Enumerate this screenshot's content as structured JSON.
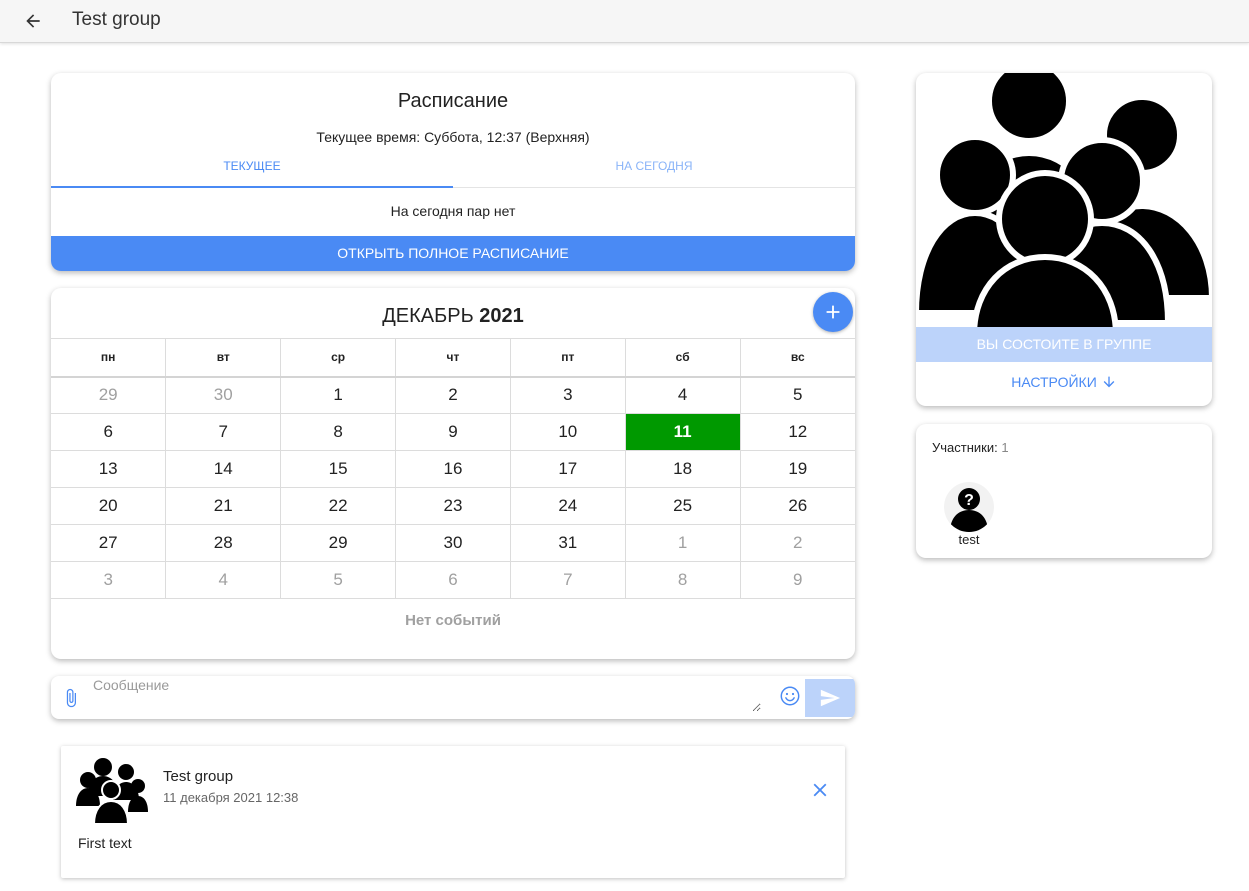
{
  "header": {
    "title": "Test group",
    "back_icon": "arrow-left-icon"
  },
  "schedule": {
    "title": "Расписание",
    "current_time": "Текущее время: Суббота, 12:37 (Верхняя)",
    "tabs": [
      {
        "label": "ТЕКУЩЕЕ",
        "active": true
      },
      {
        "label": "НА СЕГОДНЯ",
        "active": false
      }
    ],
    "no_classes_text": "На сегодня пар нет",
    "open_full_label": "ОТКРЫТЬ ПОЛНОЕ РАСПИСАНИЕ",
    "accent_color": "#4a8af4"
  },
  "calendar": {
    "month": "ДЕКАБРЬ",
    "year": "2021",
    "add_icon": "plus-icon",
    "weekdays": [
      "пн",
      "вт",
      "ср",
      "чт",
      "пт",
      "сб",
      "вс"
    ],
    "weeks": [
      [
        {
          "d": "29",
          "m": true
        },
        {
          "d": "30",
          "m": true
        },
        {
          "d": "1"
        },
        {
          "d": "2"
        },
        {
          "d": "3"
        },
        {
          "d": "4"
        },
        {
          "d": "5"
        }
      ],
      [
        {
          "d": "6"
        },
        {
          "d": "7"
        },
        {
          "d": "8"
        },
        {
          "d": "9"
        },
        {
          "d": "10"
        },
        {
          "d": "11",
          "today": true
        },
        {
          "d": "12"
        }
      ],
      [
        {
          "d": "13"
        },
        {
          "d": "14"
        },
        {
          "d": "15"
        },
        {
          "d": "16"
        },
        {
          "d": "17"
        },
        {
          "d": "18"
        },
        {
          "d": "19"
        }
      ],
      [
        {
          "d": "20"
        },
        {
          "d": "21"
        },
        {
          "d": "22"
        },
        {
          "d": "23"
        },
        {
          "d": "24"
        },
        {
          "d": "25"
        },
        {
          "d": "26"
        }
      ],
      [
        {
          "d": "27"
        },
        {
          "d": "28"
        },
        {
          "d": "29"
        },
        {
          "d": "30"
        },
        {
          "d": "31"
        },
        {
          "d": "1",
          "m": true
        },
        {
          "d": "2",
          "m": true
        }
      ],
      [
        {
          "d": "3",
          "m": true
        },
        {
          "d": "4",
          "m": true
        },
        {
          "d": "5",
          "m": true
        },
        {
          "d": "6",
          "m": true
        },
        {
          "d": "7",
          "m": true
        },
        {
          "d": "8",
          "m": true
        },
        {
          "d": "9",
          "m": true
        }
      ]
    ],
    "today_color": "#009900",
    "no_events_text": "Нет событий"
  },
  "composer": {
    "placeholder": "Сообщение",
    "attach_icon": "paperclip-icon",
    "emoji_icon": "smiley-icon",
    "send_icon": "send-icon"
  },
  "post": {
    "author": "Test group",
    "date": "11 декабря 2021 12:38",
    "text": "First text",
    "avatar_icon": "group-icon",
    "close_icon": "close-icon"
  },
  "group_card": {
    "image_icon": "group-icon",
    "member_status_label": "ВЫ СОСТОИТЕ В ГРУППЕ",
    "settings_label": "НАСТРОЙКИ",
    "settings_icon": "arrow-down-icon"
  },
  "participants": {
    "label": "Участники:",
    "count": "1",
    "members": [
      {
        "name": "test",
        "avatar_icon": "unknown-user-icon"
      }
    ]
  }
}
